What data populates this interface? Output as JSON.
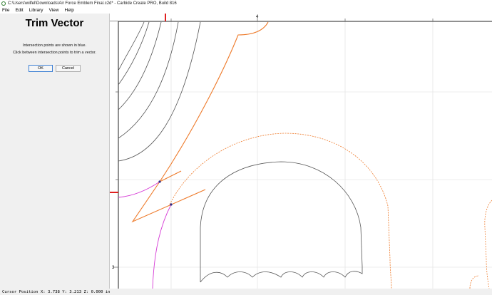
{
  "window": {
    "title": "C:\\Users\\wilfel\\Downloads\\Air Force Emblem Final.c2d* - Carbide Create PRO, Build 816",
    "app_icon": "carbide-create-icon"
  },
  "menu": {
    "items": [
      "File",
      "Edit",
      "Library",
      "View",
      "Help"
    ]
  },
  "panel": {
    "title": "Trim Vector",
    "line1": "Intersection points are shown in blue.",
    "line2": "Click between intersection points to trim a vector.",
    "ok_label": "OK",
    "cancel_label": "Cancel"
  },
  "canvas": {
    "top_ruler_label": "4",
    "left_ruler_label": "3",
    "colors": {
      "vector": "#555555",
      "selected": "#ee7a2a",
      "magenta": "#d63bd6",
      "intersection": "#2a2a8a",
      "grid": "#dddddd",
      "marker": "#e02020"
    }
  },
  "status": {
    "text": "Cursor Position X: 3.738 Y: 3.213 Z: 0.000 in"
  }
}
